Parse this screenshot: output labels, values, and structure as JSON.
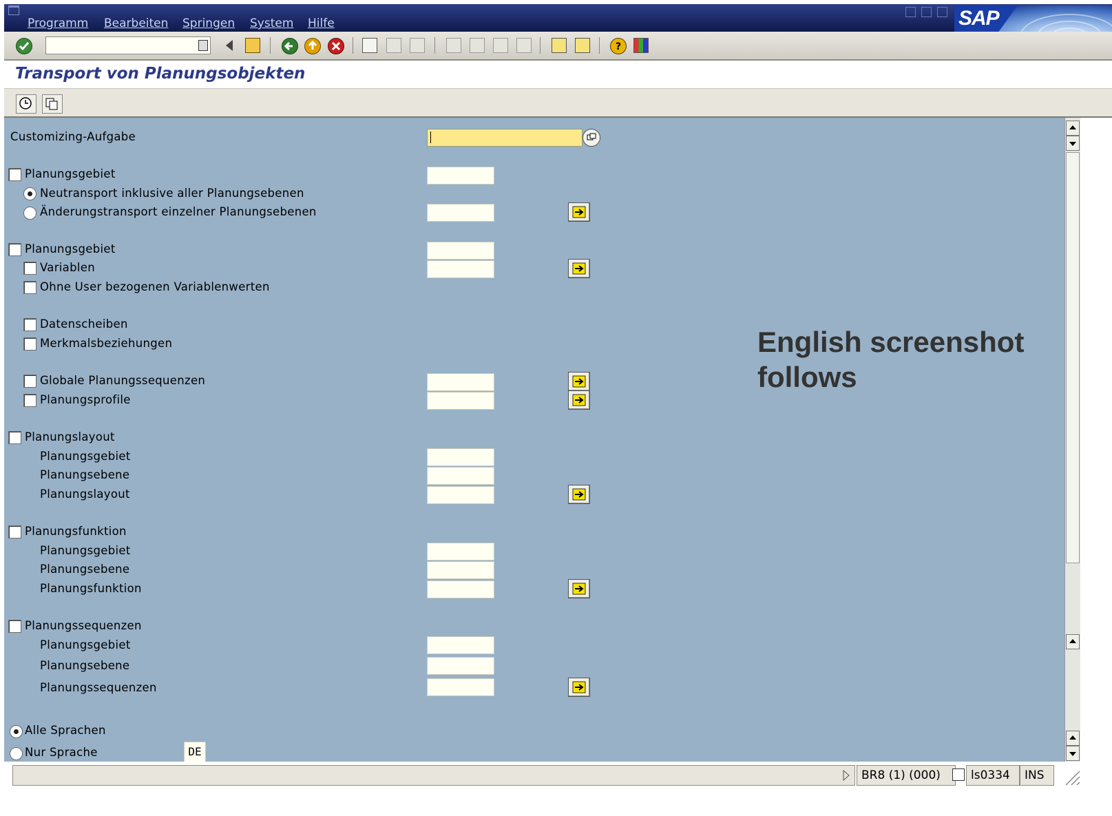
{
  "menu": {
    "items": [
      "Programm",
      "Bearbeiten",
      "Springen",
      "System",
      "Hilfe"
    ],
    "logo": "SAP"
  },
  "toolbar": {
    "command_value": "",
    "icons": [
      "enter-check-icon",
      "dropdown-icon",
      "back-triangle-icon",
      "save-icon",
      "back-icon",
      "exit-icon",
      "cancel-icon",
      "print-icon",
      "find-icon",
      "find-next-icon",
      "first-page-icon",
      "prev-page-icon",
      "next-page-icon",
      "last-page-icon",
      "new-session-icon",
      "shortcut-icon",
      "help-icon",
      "layout-menu-icon"
    ]
  },
  "page": {
    "title": "Transport  von Planungsobjekten"
  },
  "form": {
    "customizing_label": "Customizing-Aufgabe",
    "customizing_value": "",
    "s1": {
      "label": "Planungsgebiet",
      "radio_neu": "Neutransport inklusive aller Planungsebenen",
      "radio_aend": "Änderungstransport einzelner Planungsebenen"
    },
    "s2": {
      "label": "Planungsgebiet",
      "variablen": "Variablen",
      "ohne_user": "Ohne User bezogenen Variablenwerten",
      "datenscheiben": "Datenscheiben",
      "merkmal": "Merkmalsbeziehungen",
      "globale": "Globale Planungssequenzen",
      "profile": "Planungsprofile"
    },
    "s3": {
      "label": "Planungslayout",
      "gebiet": "Planungsgebiet",
      "ebene": "Planungsebene",
      "layout": "Planungslayout"
    },
    "s4": {
      "label": "Planungsfunktion",
      "gebiet": "Planungsgebiet",
      "ebene": "Planungsebene",
      "funktion": "Planungsfunktion"
    },
    "s5": {
      "label": "Planungssequenzen",
      "gebiet": "Planungsgebiet",
      "ebene": "Planungsebene",
      "sequenzen": "Planungssequenzen"
    },
    "lang_all": "Alle Sprachen",
    "lang_only": "Nur Sprache",
    "lang_value": "DE"
  },
  "note": {
    "line1": "English screenshot",
    "line2": "follows"
  },
  "status": {
    "system": "BR8 (1) (000)",
    "server": "ls0334",
    "mode": "INS"
  },
  "colors": {
    "main_bg": "#98b1c7",
    "title": "#2d3a87",
    "required_field": "#fde88a"
  }
}
